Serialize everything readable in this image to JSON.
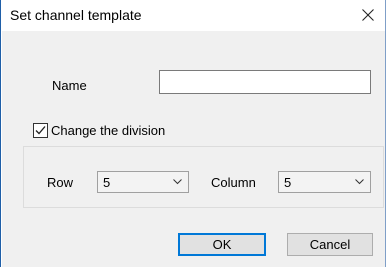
{
  "dialog": {
    "title": "Set channel template",
    "close_icon": "close-icon"
  },
  "form": {
    "name_label": "Name",
    "name_value": "",
    "change_division_label": "Change the division",
    "change_division_checked": true,
    "row_label": "Row",
    "row_value": "5",
    "column_label": "Column",
    "column_value": "5"
  },
  "buttons": {
    "ok_label": "OK",
    "cancel_label": "Cancel"
  },
  "colors": {
    "accent": "#0078d7",
    "content_background": "#f0f0f0"
  }
}
